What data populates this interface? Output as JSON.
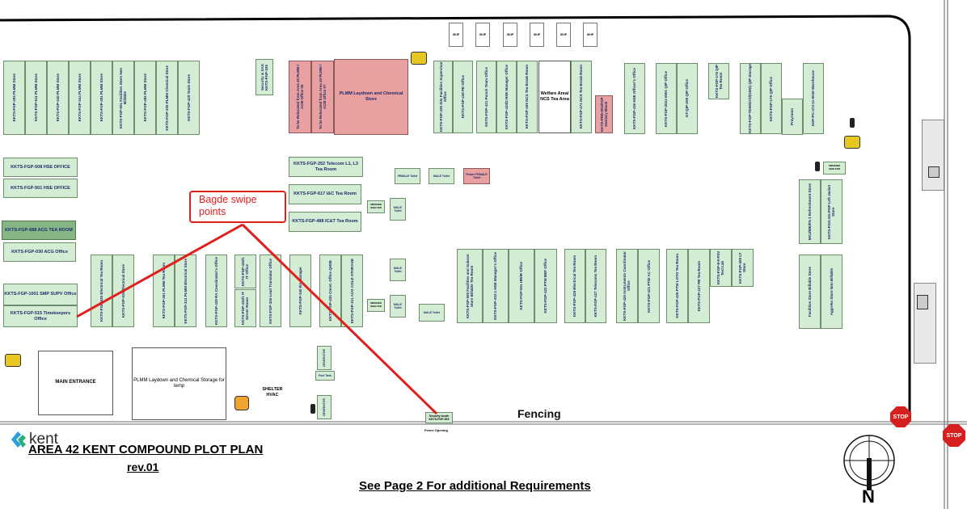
{
  "row1": [
    "KKTS-FGP-493 PLMM Store",
    "KKTS-FGP-511 PLMM Store",
    "KKTS-FGP-340 PLMM Store",
    "KKTS-FGP-344 PLMM Store",
    "KKTS-FGP-491 PLMM Store",
    "KKTS-FGP-601 Facilities Store Non Billable",
    "KKTS-FGP-492 PLMM Store",
    "KKTS-FGP-335 PLMM Chemical Store",
    "KKTS-FGP-429 Tools Store"
  ],
  "security": "Security & SAS KKTS-FGP-325",
  "relocated1": "To be Relocated from Area 40 PLMM / ACM Office 06",
  "relocated2": "To be Relocated from Area 40 PLMM / ACM Office 07",
  "laydown_store": "PLMM Laydown and Chemical Store",
  "top_mid": [
    "KKTS-FGP-435 Site Facilities Supervisor Office",
    "Site Facilities Supervisor & Upgrader",
    "KKTS-FGP-438 PE Office",
    "KKTS-FGP-431 Punch Team Office",
    "KKTS-FGP-433/2 HSE Manager Office",
    "Existing unit",
    "KKTS-FGP-469 NCS Tea Break Room",
    "Welfare Area/ NCS Tea Area",
    "KKTS-FGP-471 NCS Tea Break Room",
    "KKTS-FRD-001/FGP Sanitary Block"
  ],
  "top_right": [
    "KKTS-FGP-436 HSE Officer's Office",
    "KKTS-FGP-2021-0001 QIP Office",
    "GT-QIP-259 QIP Office",
    "KKTS-FGP-176 QIP Tea Room",
    "KKTS-FGP-TD09/272/(GMS) QIP Storage",
    "KKTS-FGP-176 QIP Office",
    "Prayroom",
    "SGP-PC-473-11-0049 Warehouse"
  ],
  "skips": [
    "SKIP",
    "SKIP",
    "SKIP",
    "SKIP",
    "SKIP",
    "SKIP"
  ],
  "hse1": "KKTS-FGP-508 HSE OFFICE",
  "hse2": "KKTS-FGP-501 HSE OFFICE",
  "acg_tea": "KKTS-FGP-688 ACG TEA ROOM",
  "acg_office": "KKTS-FGP-030 ACG Office",
  "smp": "KKTS-FGP-1001 SMP SUPV Office",
  "timekeepers": "KKTS-FGP-515 Timekeepers Office",
  "telecom": "KKTS-FGP-252 Telecom L1, L3 Tea Room",
  "ic_tea": "KKTS-FGP-617 I&C Tea Room",
  "icbt_tea": "KKTS-FGP-488 IC&T Tea Room",
  "female_toilet1": "FEMALE Toilet",
  "male_toilet1": "MALE Toilet",
  "female_toilet2": "Future FEMALE Toilet",
  "smoking1": "SMOKING SHELTER",
  "male_toilet2": "MALE Toilet",
  "smoking2": "SMOKING SHELTER",
  "row3a": [
    "KKTS-FGP-636 Electrical Tea Room",
    "KKTS-FGP-635 Electrical Store",
    "KKTS-FGP-361 PLMM Tea Room",
    "KKTS-FGP-341 PLMM Electrical Store",
    "KKTS-FGP-429 RA Coordinator's Office",
    "KKTS-FGP-432/1 IT Office",
    "KKTS-FGP-432/1 IT Server Room",
    "KKTS-FGP-326 Lead Translator Office",
    "KKTS-FGP-340 RA Manager",
    "KKTS-FGP-420 Const. Office QHSE",
    "KKTS-FGP-311 ACG COLD STORAGE"
  ],
  "male_toilet3": "MALE Toilet",
  "male_toilet4": "MALE Toilet",
  "male_toilet5": "MALE Toilet",
  "row3b": [
    "KKTS-FGP-500 Facilities and Subcon Store Billable Tea Room",
    "KKTS-FGP-433-1 HSE Manager's Office",
    "KKTS-FGP-431-2 HC/CC Office",
    "KKTS-FGP-501 HR/IR Office",
    "KKTS-FGP-422 PTW BEF Office",
    "KKTS-FGP-428 Electrical Tea Room",
    "KKTS-FGP-427 Telecoms Tea Room",
    "KKTS-FGP-425 Instruments Coordinator Office",
    "KKTS-FGP-421 PTW AC Office",
    "KKTS-FGP-425 PTW LOTO Tea Room",
    "KKTS-FGP-437 PB Tea Room",
    "KKTS-FGP-8-9 PSV Test Lab",
    "KKTS-FGP-309 LT Store"
  ],
  "right_col": [
    "MGJ/ME/FN 3 Refreshment Store",
    "KKTS-FGG-SG-PGP Left Jacket Store",
    "Facilities Store Billable Store",
    "Aggreko Store Non Billable"
  ],
  "smoking3": "SMOKING SHELTER",
  "main_entrance": "MAIN ENTRANCE",
  "laydown_temp": "PLMM Laydown and Chemical Storage for temp",
  "shelter_hvac": "SHELTER HVAC",
  "fuel_tank": "Fuel Tank",
  "generator1": "GENERATOR",
  "generator2": "GENERATOR",
  "security_booth": "Security booth KKTS-FGP-503",
  "fence_opening": "Fence Opening",
  "callout": "Bagde swipe points",
  "fencing": "Fencing",
  "stop1": "STOP",
  "stop2": "STOP",
  "logo": "kent",
  "title": "AREA 42 KENT COMPOUND PLOT PLAN",
  "rev": "rev.01",
  "footer": "See Page 2 For additional Requirements",
  "north": "N",
  "colors": {
    "building": "#d4ecd4",
    "pink": "#e9a0a0",
    "callout": "#e0201c"
  }
}
